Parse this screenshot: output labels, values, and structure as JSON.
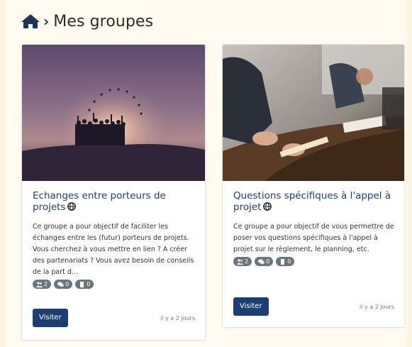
{
  "page": {
    "title": "Mes groupes"
  },
  "icons": {
    "home": "home-icon",
    "chevron": "chevron-right-icon",
    "globe": "globe-icon",
    "members": "users-icon",
    "comments": "comments-icon",
    "documents": "file-icon"
  },
  "colors": {
    "accent": "#1c3f73",
    "link": "#1d3f7c",
    "badge": "#6c757d",
    "background": "#fdf5df"
  },
  "groups": [
    {
      "title": "Echanges entre porteurs de projets",
      "description": "Ce groupe a pour objectif de faciliter les échanges entre les (futur) porteurs de projets. Vous cherchez à vous mettre en lien ? A créer des partenariats ? Vous avez besoin de conseils de la part d...",
      "members": "2",
      "comments": "0",
      "documents": "0",
      "button": "Visiter",
      "time": "il y a 2 jours"
    },
    {
      "title": "Questions spécifiques à l'appel à projet",
      "description": "Ce groupe a pour objectif de vous permettre de poser vos questions spécifiques à l'appel à projet sur le règlement, le planning, etc.",
      "members": "2",
      "comments": "0",
      "documents": "0",
      "button": "Visiter",
      "time": "il y a 2 jours"
    }
  ]
}
